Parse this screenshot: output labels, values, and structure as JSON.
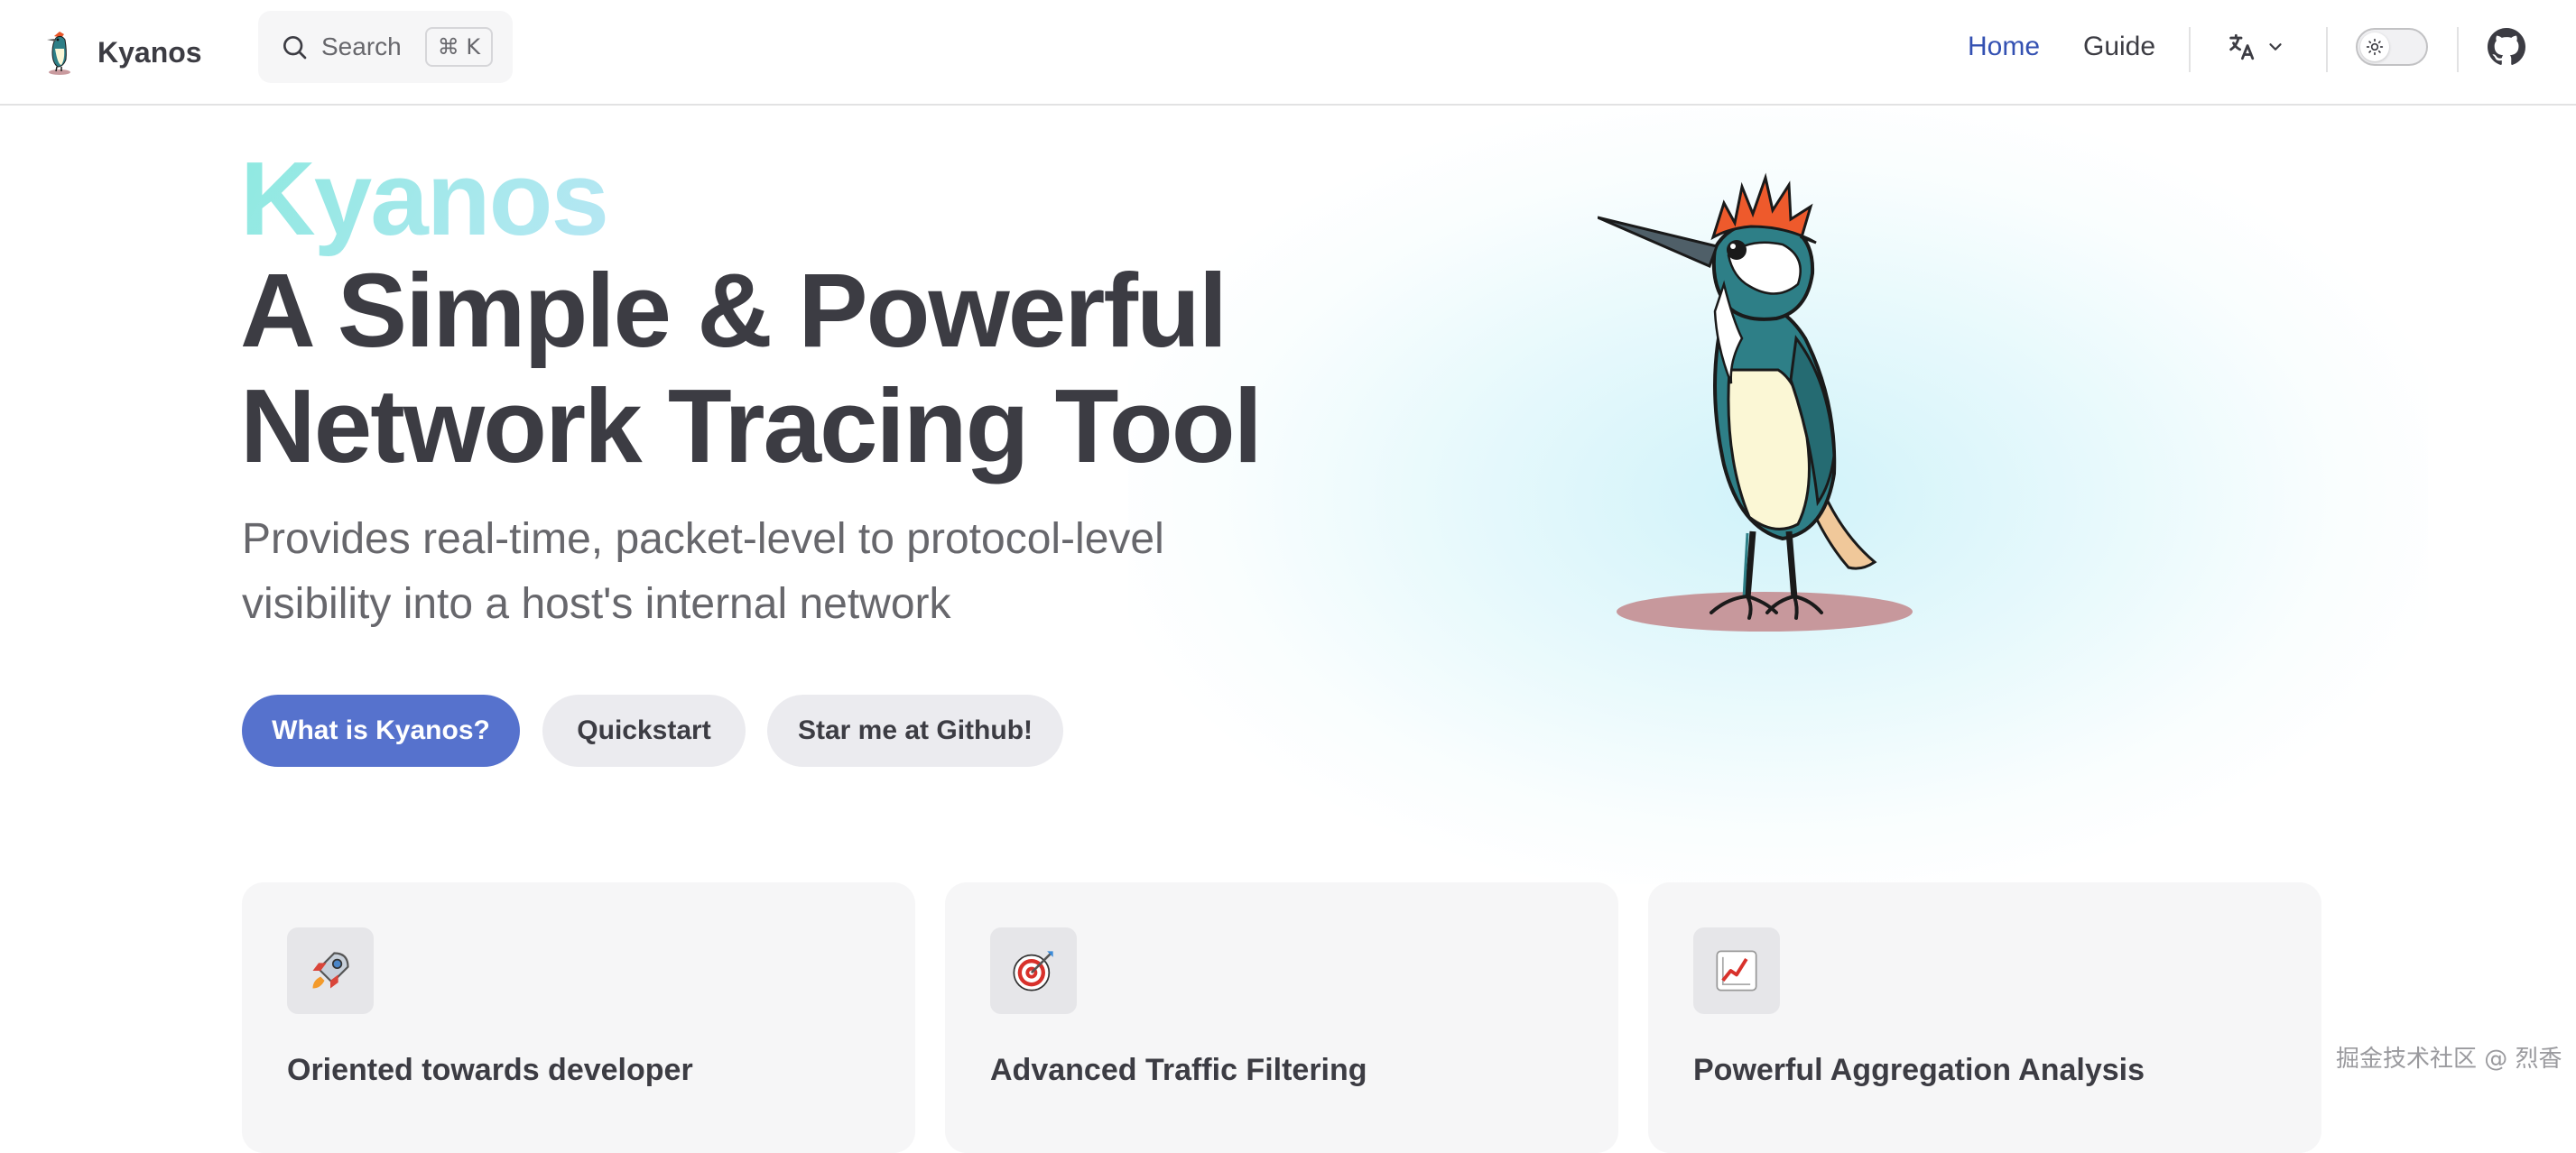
{
  "nav": {
    "brand_name": "Kyanos",
    "search_label": "Search",
    "search_shortcut": "⌘ K",
    "links": [
      "Home",
      "Guide"
    ]
  },
  "hero": {
    "name": "Kyanos",
    "title": "A Simple & Powerful Network Tracing Tool",
    "tagline": "Provides real-time, packet-level to protocol-level visibility into a host's internal network",
    "actions": [
      "What is Kyanos?",
      "Quickstart",
      "Star me at Github!"
    ]
  },
  "features": [
    {
      "icon": "rocket-icon",
      "title": "Oriented towards developer"
    },
    {
      "icon": "target-icon",
      "title": "Advanced Traffic Filtering"
    },
    {
      "icon": "chart-increasing-icon",
      "title": "Powerful Aggregation Analysis"
    }
  ],
  "watermark": "掘金技术社区 @ 烈香",
  "colors": {
    "brand": "#3451b2",
    "primary_button": "#5672cd",
    "name_gradient_start": "#8ee9e0",
    "name_gradient_end": "#b7e7f4"
  }
}
